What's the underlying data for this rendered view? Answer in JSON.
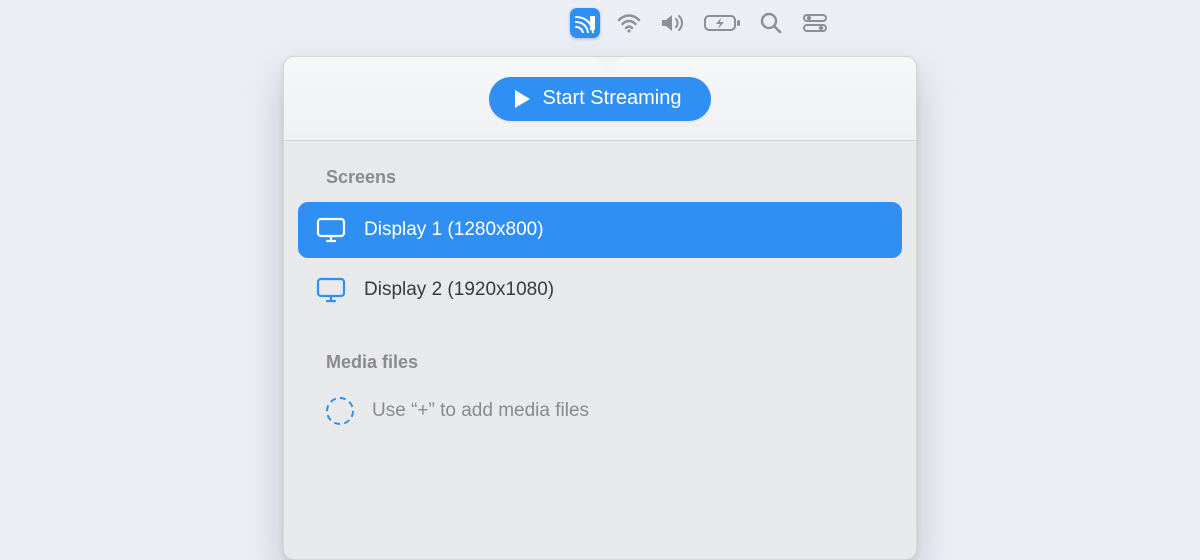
{
  "menubar": {
    "cast_active": true
  },
  "popover": {
    "start_label": "Start Streaming",
    "screens_label": "Screens",
    "screens": [
      {
        "label": "Display 1 (1280x800)",
        "selected": true
      },
      {
        "label": "Display 2 (1920x1080)",
        "selected": false
      }
    ],
    "media_label": "Media files",
    "media_empty_hint": "Use “+” to add media files"
  }
}
